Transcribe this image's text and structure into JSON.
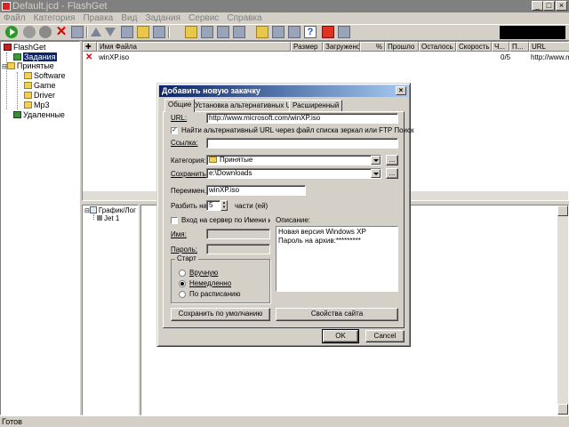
{
  "window": {
    "title": "Default.jcd - FlashGet",
    "status": "Готов"
  },
  "menu": [
    "Файл",
    "Категория",
    "Правка",
    "Вид",
    "Задания",
    "Сервис",
    "Справка"
  ],
  "tree": {
    "root": "FlashGet",
    "jobs": "Задания",
    "downloaded": "Принятые",
    "software": "Software",
    "game": "Game",
    "driver": "Driver",
    "mp3": "Mp3",
    "deleted": "Удаленные"
  },
  "list": {
    "headers": [
      "Имя Файла",
      "Размер",
      "Загружено",
      "%",
      "Прошло",
      "Осталось",
      "Скорость",
      "Ч...",
      "П...",
      "URL"
    ],
    "rows": [
      {
        "name": "winXP.iso",
        "size": "",
        "downloaded": "",
        "percent": "",
        "elapsed": "",
        "left": "",
        "speed": "",
        "c": "",
        "p": "0/5",
        "url": "http://www.m"
      }
    ]
  },
  "log": {
    "graph": "График/Лог",
    "jet": "Jet 1"
  },
  "dialog": {
    "title": "Добавить новую закачку",
    "tabs": [
      "Общие",
      "Установка альтернативных URL",
      "Расширенный"
    ],
    "url_label": "URL:",
    "url_value": "http://www.microsoft.com/winXP.iso",
    "mirror_check": "Найти альтернативный URL через файл списка зеркал или FTP Поиск",
    "mirror_checked": true,
    "referer_label": "Ссылка:",
    "referer_value": "",
    "category_label": "Категория:",
    "category_value": "Принятые",
    "save_label": "Сохранить:",
    "save_value": "e:\\Downloads",
    "browse": "...",
    "rename_label": "Переимен.",
    "rename_value": "winXP.iso",
    "split_label": "Разбить на",
    "split_value": "5",
    "split_suffix": "части (ей)",
    "login_check": "Вход на сервер по Имени и Пар",
    "login_checked": false,
    "user_label": "Имя:",
    "pass_label": "Пароль:",
    "description_label": "Описание:",
    "description": "Новая версия Windows XP\nПароль на архив:*********",
    "start_group": "Старт",
    "start_options": [
      "Вручную",
      "Немедленно",
      "По расписанию"
    ],
    "start_selected": 1,
    "save_default": "Сохранить по умолчанию",
    "site_props": "Свойства сайта",
    "ok": "OK",
    "cancel": "Cancel"
  }
}
